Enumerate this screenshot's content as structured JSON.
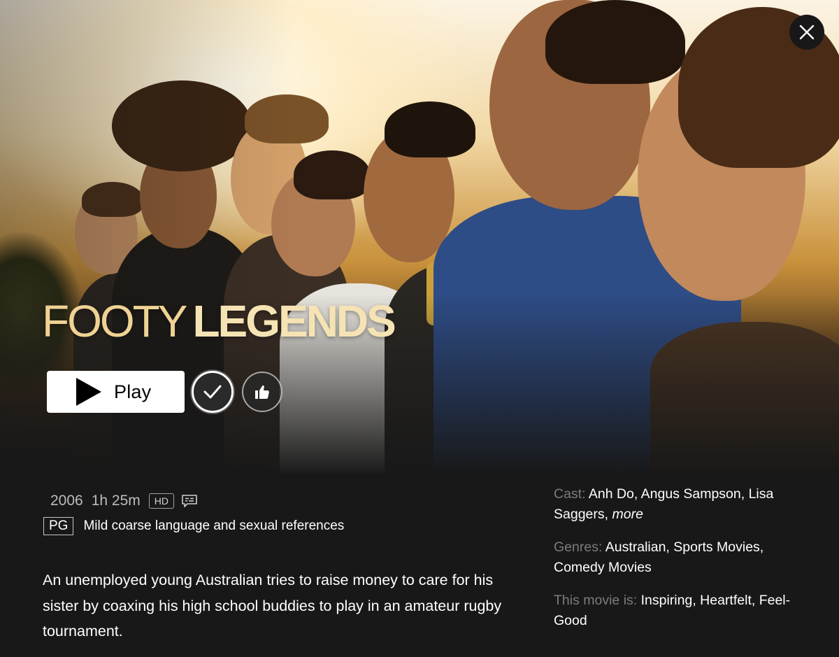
{
  "title": {
    "word1": "FOOTY",
    "word2": "LEGENDS"
  },
  "controls": {
    "play_label": "Play",
    "close_icon": "close-icon",
    "mylist_icon": "checkmark-icon",
    "rate_icon": "thumbs-up-icon"
  },
  "meta": {
    "year": "2006",
    "runtime": "1h 25m",
    "quality": "HD",
    "subtitles_icon": "subtitles-icon"
  },
  "rating": {
    "value": "PG",
    "reason": "Mild coarse language and sexual references"
  },
  "synopsis": "An unemployed young Australian tries to raise money to care for his sister by coaxing his high school buddies to play in an amateur rugby tournament.",
  "details": {
    "cast_label": "Cast:",
    "cast_value": "Anh Do, Angus Sampson, Lisa Saggers,",
    "cast_more": "more",
    "genres_label": "Genres:",
    "genres_value": "Australian, Sports Movies, Comedy Movies",
    "tags_label": "This movie is:",
    "tags_value": "Inspiring, Heartfelt, Feel-Good"
  },
  "colors": {
    "background": "#181818",
    "title_gold": "#f0d69a",
    "label_gray": "#7c7c7c"
  }
}
